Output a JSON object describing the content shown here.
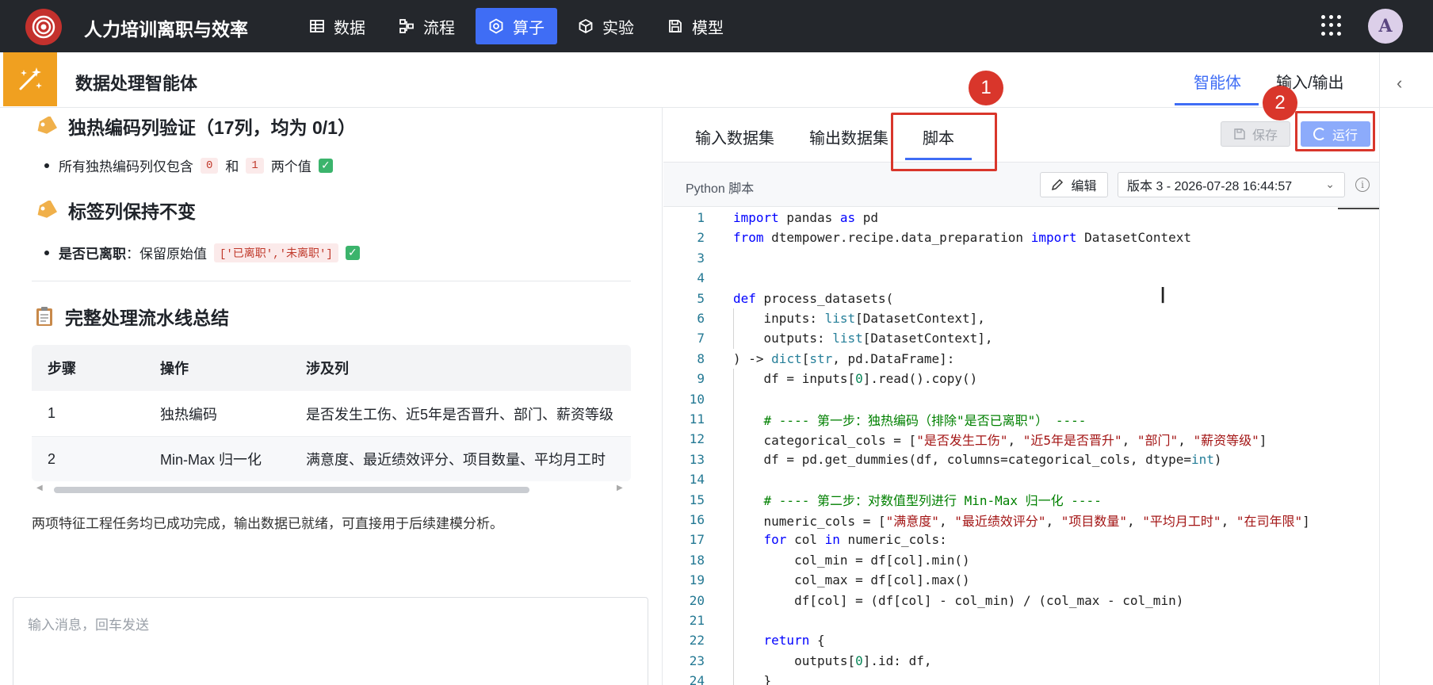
{
  "app": {
    "title": "人力培训离职与效率"
  },
  "nav": [
    {
      "label": "数据",
      "icon": "table-icon",
      "active": false
    },
    {
      "label": "流程",
      "icon": "flow-icon",
      "active": false
    },
    {
      "label": "算子",
      "icon": "operator-icon",
      "active": true
    },
    {
      "label": "实验",
      "icon": "cube-icon",
      "active": false
    },
    {
      "label": "模型",
      "icon": "save-model-icon",
      "active": false
    }
  ],
  "user": {
    "avatar": "A"
  },
  "subheader": {
    "title": "数据处理智能体",
    "tabs": [
      {
        "label": "智能体",
        "active": true
      },
      {
        "label": "输入/输出",
        "active": false
      }
    ],
    "collapse": "‹"
  },
  "left": {
    "section1": {
      "heading": "独热编码列验证（17列，均为 0/1）",
      "bullet_prefix": "所有独热编码列仅包含",
      "chip_a": "0",
      "and": "和",
      "chip_b": "1",
      "bullet_suffix": "两个值"
    },
    "section2": {
      "heading": "标签列保持不变",
      "bold": "是否已离职",
      "text": "：保留原始值",
      "chip": "['已离职','未离职']"
    },
    "section3": {
      "heading": "完整处理流水线总结"
    },
    "table": {
      "headers": [
        "步骤",
        "操作",
        "涉及列"
      ],
      "rows": [
        [
          "1",
          "独热编码",
          "是否发生工伤、近5年是否晋升、部门、薪资等级"
        ],
        [
          "2",
          "Min-Max 归一化",
          "满意度、最近绩效评分、项目数量、平均月工时"
        ]
      ]
    },
    "summary": "两项特征工程任务均已成功完成，输出数据已就绪，可直接用于后续建模分析。",
    "chat_placeholder": "输入消息，回车发送"
  },
  "right": {
    "tabs": [
      {
        "label": "输入数据集"
      },
      {
        "label": "输出数据集"
      },
      {
        "label": "脚本",
        "active": true
      }
    ],
    "save_label": "保存",
    "run_label": "运行",
    "annotations": [
      "1",
      "2"
    ],
    "toolbar": {
      "label": "Python 脚本",
      "edit_label": "编辑",
      "version": "版本 3 - 2026-07-28 16:44:57",
      "info": "i"
    }
  },
  "code": {
    "line_numbers": [
      "1",
      "2",
      "3",
      "4",
      "5",
      "6",
      "7",
      "8",
      "9",
      "10",
      "11",
      "12",
      "13",
      "14",
      "15",
      "16",
      "17",
      "18",
      "19",
      "20",
      "21",
      "22",
      "23",
      "24"
    ],
    "lines": [
      [
        [
          "kw",
          "import"
        ],
        [
          "t",
          " pandas "
        ],
        [
          "kw",
          "as"
        ],
        [
          "t",
          " pd"
        ]
      ],
      [
        [
          "kw",
          "from"
        ],
        [
          "t",
          " dtempower.recipe.data_preparation "
        ],
        [
          "kw",
          "import"
        ],
        [
          "t",
          " DatasetContext"
        ]
      ],
      [],
      [],
      [
        [
          "kw",
          "def"
        ],
        [
          "t",
          " process_datasets("
        ]
      ],
      [
        [
          "t",
          "    inputs: "
        ],
        [
          "bi",
          "list"
        ],
        [
          "t",
          "[DatasetContext],"
        ]
      ],
      [
        [
          "t",
          "    outputs: "
        ],
        [
          "bi",
          "list"
        ],
        [
          "t",
          "[DatasetContext],"
        ]
      ],
      [
        [
          "t",
          ") -> "
        ],
        [
          "bi",
          "dict"
        ],
        [
          "t",
          "["
        ],
        [
          "bi",
          "str"
        ],
        [
          "t",
          ", pd.DataFrame]:"
        ]
      ],
      [
        [
          "t",
          "    df = inputs["
        ],
        [
          "num",
          "0"
        ],
        [
          "t",
          "].read().copy()"
        ]
      ],
      [],
      [
        [
          "com",
          "    # ---- 第一步：独热编码（排除\"是否已离职\"） ----"
        ]
      ],
      [
        [
          "t",
          "    categorical_cols = ["
        ],
        [
          "str",
          "\"是否发生工伤\""
        ],
        [
          "t",
          ", "
        ],
        [
          "str",
          "\"近5年是否晋升\""
        ],
        [
          "t",
          ", "
        ],
        [
          "str",
          "\"部门\""
        ],
        [
          "t",
          ", "
        ],
        [
          "str",
          "\"薪资等级\""
        ],
        [
          "t",
          "]"
        ]
      ],
      [
        [
          "t",
          "    df = pd.get_dummies(df, columns=categorical_cols, dtype="
        ],
        [
          "bi",
          "int"
        ],
        [
          "t",
          ")"
        ]
      ],
      [],
      [
        [
          "com",
          "    # ---- 第二步：对数值型列进行 Min-Max 归一化 ----"
        ]
      ],
      [
        [
          "t",
          "    numeric_cols = ["
        ],
        [
          "str",
          "\"满意度\""
        ],
        [
          "t",
          ", "
        ],
        [
          "str",
          "\"最近绩效评分\""
        ],
        [
          "t",
          ", "
        ],
        [
          "str",
          "\"项目数量\""
        ],
        [
          "t",
          ", "
        ],
        [
          "str",
          "\"平均月工时\""
        ],
        [
          "t",
          ", "
        ],
        [
          "str",
          "\"在司年限\""
        ],
        [
          "t",
          "]"
        ]
      ],
      [
        [
          "t",
          "    "
        ],
        [
          "kw",
          "for"
        ],
        [
          "t",
          " col "
        ],
        [
          "kw",
          "in"
        ],
        [
          "t",
          " numeric_cols:"
        ]
      ],
      [
        [
          "t",
          "        col_min = df[col].min()"
        ]
      ],
      [
        [
          "t",
          "        col_max = df[col].max()"
        ]
      ],
      [
        [
          "t",
          "        df[col] = (df[col] - col_min) / (col_max - col_min)"
        ]
      ],
      [],
      [
        [
          "t",
          "    "
        ],
        [
          "kw",
          "return"
        ],
        [
          "t",
          " {"
        ]
      ],
      [
        [
          "t",
          "        outputs["
        ],
        [
          "num",
          "0"
        ],
        [
          "t",
          "].id: df,"
        ]
      ],
      [
        [
          "t",
          "    }"
        ]
      ]
    ]
  },
  "colors": {
    "accent": "#3f6df5",
    "topbar": "#24272c",
    "annotation": "#d9362b",
    "agent_icon": "#f0a020"
  }
}
